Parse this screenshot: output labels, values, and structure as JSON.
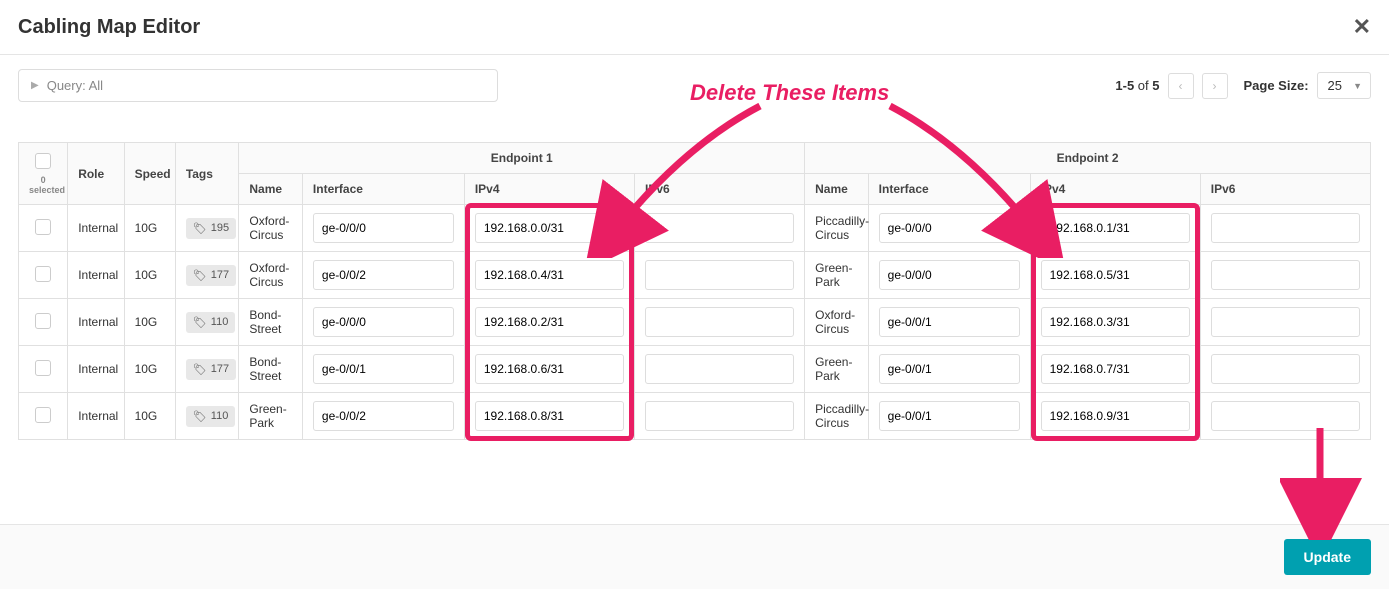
{
  "header": {
    "title": "Cabling Map Editor"
  },
  "toolbar": {
    "query_label": "Query: All",
    "pagination_range": "1-5",
    "pagination_of": " of ",
    "pagination_total": "5",
    "page_size_label": "Page Size:",
    "page_size_value": "25"
  },
  "columns": {
    "selected_label": "0 selected",
    "role": "Role",
    "speed": "Speed",
    "tags": "Tags",
    "endpoint1": "Endpoint 1",
    "endpoint2": "Endpoint 2",
    "name": "Name",
    "interface": "Interface",
    "ipv4": "IPv4",
    "ipv6": "IPv6"
  },
  "rows": [
    {
      "role": "Internal",
      "speed": "10G",
      "tag": "195",
      "ep1_name": "Oxford-Circus",
      "ep1_if": "ge-0/0/0",
      "ep1_v4": "192.168.0.0/31",
      "ep1_v6": "",
      "ep2_name": "Piccadilly-Circus",
      "ep2_if": "ge-0/0/0",
      "ep2_v4": "192.168.0.1/31",
      "ep2_v6": ""
    },
    {
      "role": "Internal",
      "speed": "10G",
      "tag": "177",
      "ep1_name": "Oxford-Circus",
      "ep1_if": "ge-0/0/2",
      "ep1_v4": "192.168.0.4/31",
      "ep1_v6": "",
      "ep2_name": "Green-Park",
      "ep2_if": "ge-0/0/0",
      "ep2_v4": "192.168.0.5/31",
      "ep2_v6": ""
    },
    {
      "role": "Internal",
      "speed": "10G",
      "tag": "110",
      "ep1_name": "Bond-Street",
      "ep1_if": "ge-0/0/0",
      "ep1_v4": "192.168.0.2/31",
      "ep1_v6": "",
      "ep2_name": "Oxford-Circus",
      "ep2_if": "ge-0/0/1",
      "ep2_v4": "192.168.0.3/31",
      "ep2_v6": ""
    },
    {
      "role": "Internal",
      "speed": "10G",
      "tag": "177",
      "ep1_name": "Bond-Street",
      "ep1_if": "ge-0/0/1",
      "ep1_v4": "192.168.0.6/31",
      "ep1_v6": "",
      "ep2_name": "Green-Park",
      "ep2_if": "ge-0/0/1",
      "ep2_v4": "192.168.0.7/31",
      "ep2_v6": ""
    },
    {
      "role": "Internal",
      "speed": "10G",
      "tag": "110",
      "ep1_name": "Green-Park",
      "ep1_if": "ge-0/0/2",
      "ep1_v4": "192.168.0.8/31",
      "ep1_v6": "",
      "ep2_name": "Piccadilly-Circus",
      "ep2_if": "ge-0/0/1",
      "ep2_v4": "192.168.0.9/31",
      "ep2_v6": ""
    }
  ],
  "footer": {
    "update_label": "Update"
  },
  "annotation": {
    "text": "Delete These Items"
  }
}
